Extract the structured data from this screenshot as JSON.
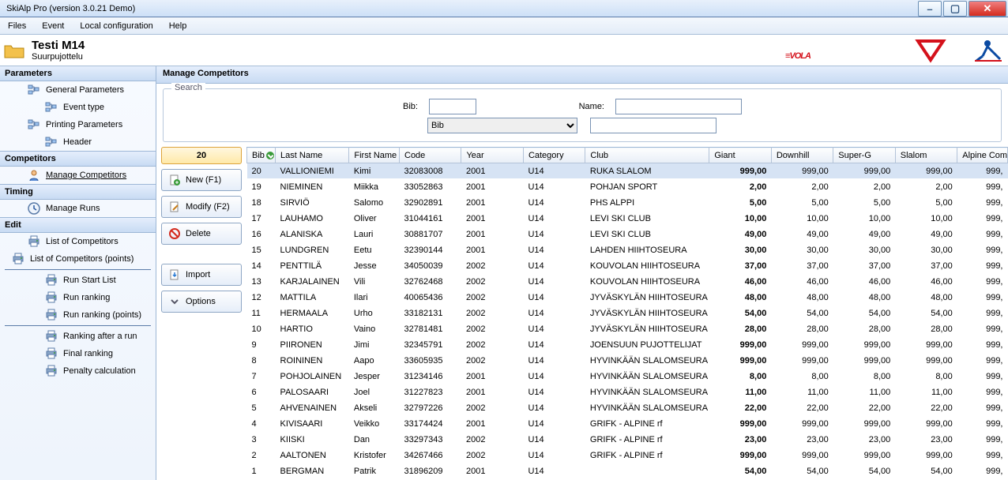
{
  "window": {
    "title": "SkiAlp Pro (version 3.0.21 Demo)"
  },
  "menu": [
    "Files",
    "Event",
    "Local configuration",
    "Help"
  ],
  "header": {
    "title": "Testi M14",
    "subtitle": "Suurpujottelu",
    "logo_text": "VOLA"
  },
  "sidebar": {
    "sections": [
      {
        "title": "Parameters",
        "items": [
          {
            "label": "General Parameters",
            "icon": "tree",
            "indent": 1
          },
          {
            "label": "Event type",
            "icon": "tree",
            "indent": 2
          },
          {
            "label": "Printing Parameters",
            "icon": "tree",
            "indent": 1
          },
          {
            "label": "Header",
            "icon": "tree",
            "indent": 2
          }
        ]
      },
      {
        "title": "Competitors",
        "items": [
          {
            "label": "Manage Competitors",
            "icon": "person",
            "indent": 1,
            "link": true
          }
        ]
      },
      {
        "title": "Timing",
        "items": [
          {
            "label": "Manage Runs",
            "icon": "clock",
            "indent": 1
          }
        ]
      },
      {
        "title": "Edit",
        "items": [
          {
            "label": "List of Competitors",
            "icon": "printer",
            "indent": 1
          },
          {
            "label": "List of Competitors (points)",
            "icon": "printer",
            "indent": 0
          },
          {
            "label": "Run Start List",
            "icon": "printer",
            "indent": 2,
            "divider_before": true
          },
          {
            "label": "Run ranking",
            "icon": "printer",
            "indent": 2
          },
          {
            "label": "Run ranking (points)",
            "icon": "printer",
            "indent": 2
          },
          {
            "label": "Ranking after a run",
            "icon": "printer",
            "indent": 2,
            "divider_before": true
          },
          {
            "label": "Final ranking",
            "icon": "printer",
            "indent": 2
          },
          {
            "label": "Penalty calculation",
            "icon": "printer",
            "indent": 2
          }
        ]
      }
    ]
  },
  "content": {
    "title": "Manage Competitors",
    "search": {
      "legend": "Search",
      "bib_label": "Bib:",
      "name_label": "Name:",
      "dropdown_value": "Bib"
    },
    "counter": "20",
    "buttons": {
      "new": "New (F1)",
      "modify": "Modify (F2)",
      "delete": "Delete",
      "import": "Import",
      "options": "Options"
    },
    "columns": [
      "Bib",
      "Last Name",
      "First Name",
      "Code",
      "Year",
      "Category",
      "Club",
      "Giant",
      "Downhill",
      "Super-G",
      "Slalom",
      "Alpine Coml"
    ],
    "rows": [
      {
        "sel": true,
        "bib": "20",
        "ln": "VALLIONIEMI",
        "fn": "Kimi",
        "code": "32083008",
        "yr": "2001",
        "cat": "U14",
        "club": "RUKA SLALOM",
        "g": "999,00",
        "d": "999,00",
        "s": "999,00",
        "sl": "999,00",
        "ac": "999,"
      },
      {
        "sel": false,
        "bib": "19",
        "ln": "NIEMINEN",
        "fn": "Miikka",
        "code": "33052863",
        "yr": "2001",
        "cat": "U14",
        "club": "POHJAN SPORT",
        "g": "2,00",
        "d": "2,00",
        "s": "2,00",
        "sl": "2,00",
        "ac": "999,"
      },
      {
        "sel": false,
        "bib": "18",
        "ln": "SIRVIÖ",
        "fn": "Salomo",
        "code": "32902891",
        "yr": "2001",
        "cat": "U14",
        "club": "PHS ALPPI",
        "g": "5,00",
        "d": "5,00",
        "s": "5,00",
        "sl": "5,00",
        "ac": "999,"
      },
      {
        "sel": false,
        "bib": "17",
        "ln": "LAUHAMO",
        "fn": "Oliver",
        "code": "31044161",
        "yr": "2001",
        "cat": "U14",
        "club": "LEVI SKI CLUB",
        "g": "10,00",
        "d": "10,00",
        "s": "10,00",
        "sl": "10,00",
        "ac": "999,"
      },
      {
        "sel": false,
        "bib": "16",
        "ln": "ALANISKA",
        "fn": "Lauri",
        "code": "30881707",
        "yr": "2001",
        "cat": "U14",
        "club": "LEVI SKI CLUB",
        "g": "49,00",
        "d": "49,00",
        "s": "49,00",
        "sl": "49,00",
        "ac": "999,"
      },
      {
        "sel": false,
        "bib": "15",
        "ln": "LUNDGREN",
        "fn": "Eetu",
        "code": "32390144",
        "yr": "2001",
        "cat": "U14",
        "club": "LAHDEN HIIHTOSEURA",
        "g": "30,00",
        "d": "30,00",
        "s": "30,00",
        "sl": "30,00",
        "ac": "999,"
      },
      {
        "sel": false,
        "bib": "14",
        "ln": "PENTTILÄ",
        "fn": "Jesse",
        "code": "34050039",
        "yr": "2002",
        "cat": "U14",
        "club": "KOUVOLAN HIIHTOSEURA",
        "g": "37,00",
        "d": "37,00",
        "s": "37,00",
        "sl": "37,00",
        "ac": "999,"
      },
      {
        "sel": false,
        "bib": "13",
        "ln": "KARJALAINEN",
        "fn": "Vili",
        "code": "32762468",
        "yr": "2002",
        "cat": "U14",
        "club": "KOUVOLAN HIIHTOSEURA",
        "g": "46,00",
        "d": "46,00",
        "s": "46,00",
        "sl": "46,00",
        "ac": "999,"
      },
      {
        "sel": false,
        "bib": "12",
        "ln": "MATTILA",
        "fn": "Ilari",
        "code": "40065436",
        "yr": "2002",
        "cat": "U14",
        "club": "JYVÄSKYLÄN HIIHTOSEURA",
        "g": "48,00",
        "d": "48,00",
        "s": "48,00",
        "sl": "48,00",
        "ac": "999,"
      },
      {
        "sel": false,
        "bib": "11",
        "ln": "HERMAALA",
        "fn": "Urho",
        "code": "33182131",
        "yr": "2002",
        "cat": "U14",
        "club": "JYVÄSKYLÄN HIIHTOSEURA",
        "g": "54,00",
        "d": "54,00",
        "s": "54,00",
        "sl": "54,00",
        "ac": "999,"
      },
      {
        "sel": false,
        "bib": "10",
        "ln": "HARTIO",
        "fn": "Vaino",
        "code": "32781481",
        "yr": "2002",
        "cat": "U14",
        "club": "JYVÄSKYLÄN HIIHTOSEURA",
        "g": "28,00",
        "d": "28,00",
        "s": "28,00",
        "sl": "28,00",
        "ac": "999,"
      },
      {
        "sel": false,
        "bib": "9",
        "ln": "PIIRONEN",
        "fn": "Jimi",
        "code": "32345791",
        "yr": "2002",
        "cat": "U14",
        "club": "JOENSUUN PUJOTTELIJAT",
        "g": "999,00",
        "d": "999,00",
        "s": "999,00",
        "sl": "999,00",
        "ac": "999,"
      },
      {
        "sel": false,
        "bib": "8",
        "ln": "ROININEN",
        "fn": "Aapo",
        "code": "33605935",
        "yr": "2002",
        "cat": "U14",
        "club": "HYVINKÄÄN SLALOMSEURA",
        "g": "999,00",
        "d": "999,00",
        "s": "999,00",
        "sl": "999,00",
        "ac": "999,"
      },
      {
        "sel": false,
        "bib": "7",
        "ln": "POHJOLAINEN",
        "fn": "Jesper",
        "code": "31234146",
        "yr": "2001",
        "cat": "U14",
        "club": "HYVINKÄÄN SLALOMSEURA",
        "g": "8,00",
        "d": "8,00",
        "s": "8,00",
        "sl": "8,00",
        "ac": "999,"
      },
      {
        "sel": false,
        "bib": "6",
        "ln": "PALOSAARI",
        "fn": "Joel",
        "code": "31227823",
        "yr": "2001",
        "cat": "U14",
        "club": "HYVINKÄÄN SLALOMSEURA",
        "g": "11,00",
        "d": "11,00",
        "s": "11,00",
        "sl": "11,00",
        "ac": "999,"
      },
      {
        "sel": false,
        "bib": "5",
        "ln": "AHVENAINEN",
        "fn": "Akseli",
        "code": "32797226",
        "yr": "2002",
        "cat": "U14",
        "club": "HYVINKÄÄN SLALOMSEURA",
        "g": "22,00",
        "d": "22,00",
        "s": "22,00",
        "sl": "22,00",
        "ac": "999,"
      },
      {
        "sel": false,
        "bib": "4",
        "ln": "KIVISAARI",
        "fn": "Veikko",
        "code": "33174424",
        "yr": "2001",
        "cat": "U14",
        "club": "GRIFK - ALPINE rf",
        "g": "999,00",
        "d": "999,00",
        "s": "999,00",
        "sl": "999,00",
        "ac": "999,"
      },
      {
        "sel": false,
        "bib": "3",
        "ln": "KIISKI",
        "fn": "Dan",
        "code": "33297343",
        "yr": "2002",
        "cat": "U14",
        "club": "GRIFK - ALPINE rf",
        "g": "23,00",
        "d": "23,00",
        "s": "23,00",
        "sl": "23,00",
        "ac": "999,"
      },
      {
        "sel": false,
        "bib": "2",
        "ln": "AALTONEN",
        "fn": "Kristofer",
        "code": "34267466",
        "yr": "2002",
        "cat": "U14",
        "club": "GRIFK - ALPINE rf",
        "g": "999,00",
        "d": "999,00",
        "s": "999,00",
        "sl": "999,00",
        "ac": "999,"
      },
      {
        "sel": false,
        "bib": "1",
        "ln": "BERGMAN",
        "fn": "Patrik",
        "code": "31896209",
        "yr": "2001",
        "cat": "U14",
        "club": "",
        "g": "54,00",
        "d": "54,00",
        "s": "54,00",
        "sl": "54,00",
        "ac": "999,"
      }
    ]
  }
}
